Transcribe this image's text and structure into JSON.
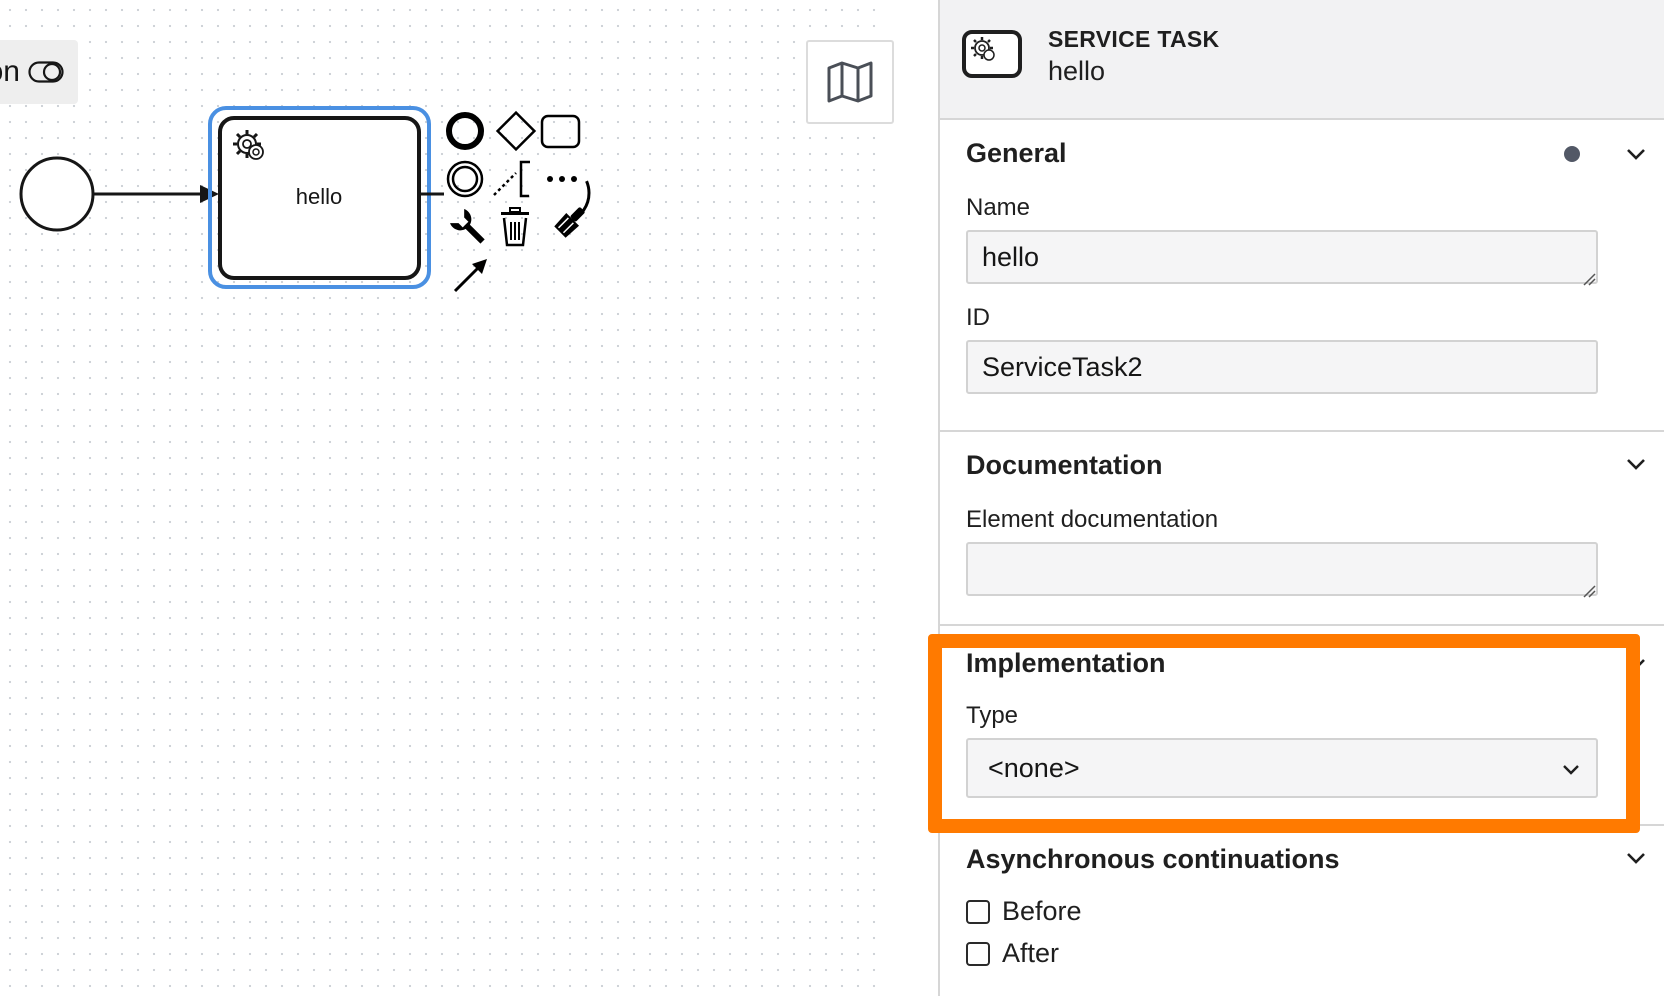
{
  "canvas": {
    "toggle_label": "on",
    "task_label": "hello",
    "icons": [
      "start-event",
      "sequence-flow-arrow",
      "service-task",
      "gear-icon",
      "append-end-event-icon",
      "append-gateway-icon",
      "append-task-icon",
      "append-intermediate-event-icon",
      "text-annotation-icon",
      "more-options-icon",
      "wrench-icon",
      "trash-icon",
      "paintbrush-icon",
      "connect-arrow-icon",
      "map-icon",
      "toggle-icon"
    ]
  },
  "panel": {
    "header": {
      "type": "SERVICE TASK",
      "name": "hello"
    },
    "general": {
      "title": "General",
      "name_label": "Name",
      "name_value": "hello",
      "id_label": "ID",
      "id_value": "ServiceTask2"
    },
    "documentation": {
      "title": "Documentation",
      "element_doc_label": "Element documentation",
      "element_doc_value": ""
    },
    "implementation": {
      "title": "Implementation",
      "type_label": "Type",
      "type_value": "<none>"
    },
    "async": {
      "title": "Asynchronous continuations",
      "before_label": "Before",
      "after_label": "After"
    }
  },
  "colors": {
    "selection_blue": "#4a90e2",
    "highlight_orange": "#ff7a00"
  }
}
